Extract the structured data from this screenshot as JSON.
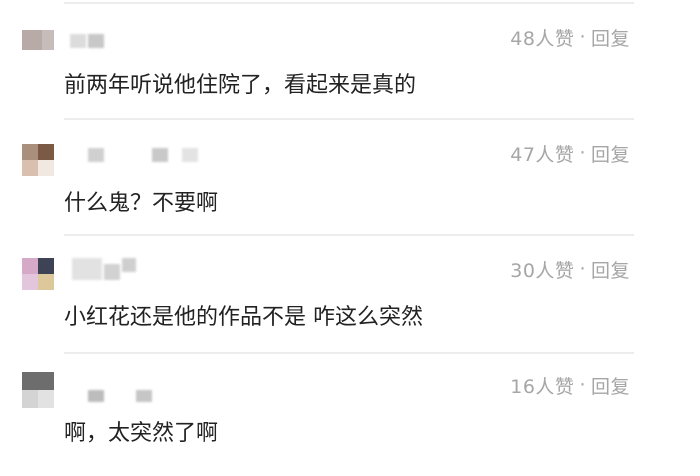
{
  "comments": [
    {
      "likes": "48人赞",
      "separator": "·",
      "reply_label": "回复",
      "text": "前两年听说他住院了，看起来是真的"
    },
    {
      "likes": "47人赞",
      "separator": "·",
      "reply_label": "回复",
      "text": "什么鬼？不要啊"
    },
    {
      "likes": "30人赞",
      "separator": "·",
      "reply_label": "回复",
      "text": "小红花还是他的作品不是 咋这么突然"
    },
    {
      "likes": "16人赞",
      "separator": "·",
      "reply_label": "回复",
      "text": "啊，太突然了啊"
    }
  ],
  "colors": {
    "meta_text": "#a6a6a6",
    "comment_text": "#222222",
    "divider": "#ececec"
  }
}
